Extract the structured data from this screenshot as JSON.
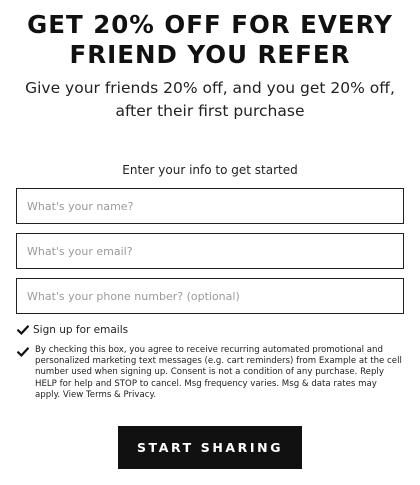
{
  "headline": {
    "line1": "GET 20% OFF FOR EVERY",
    "line2": "FRIEND YOU REFER"
  },
  "subline": {
    "line1": "Give your friends 20% off, and you get 20% off,",
    "line2": "after their first purchase"
  },
  "form": {
    "prompt": "Enter your info to get started",
    "name_placeholder": "What's your name?",
    "email_placeholder": "What's your email?",
    "phone_placeholder": "What's your phone number? (optional)",
    "name_value": "",
    "email_value": "",
    "phone_value": ""
  },
  "checkboxes": {
    "emails_label": "Sign up for emails",
    "emails_checked": true,
    "sms_consent_text": "By checking this box, you agree to receive recurring automated promotional and personalized marketing text messages (e.g. cart reminders) from Example at the cell number used when signing up. Consent is not a condition of any purchase. Reply HELP for help and STOP to cancel. Msg frequency varies. Msg & data rates may apply. View Terms & Privacy.",
    "sms_checked": true,
    "check_icon": "checkmark-icon"
  },
  "cta": {
    "label": "START SHARING"
  },
  "colors": {
    "text": "#111111",
    "button_bg": "#111111",
    "button_text": "#ffffff",
    "field_border": "#222222",
    "placeholder": "#9a9a9a"
  }
}
